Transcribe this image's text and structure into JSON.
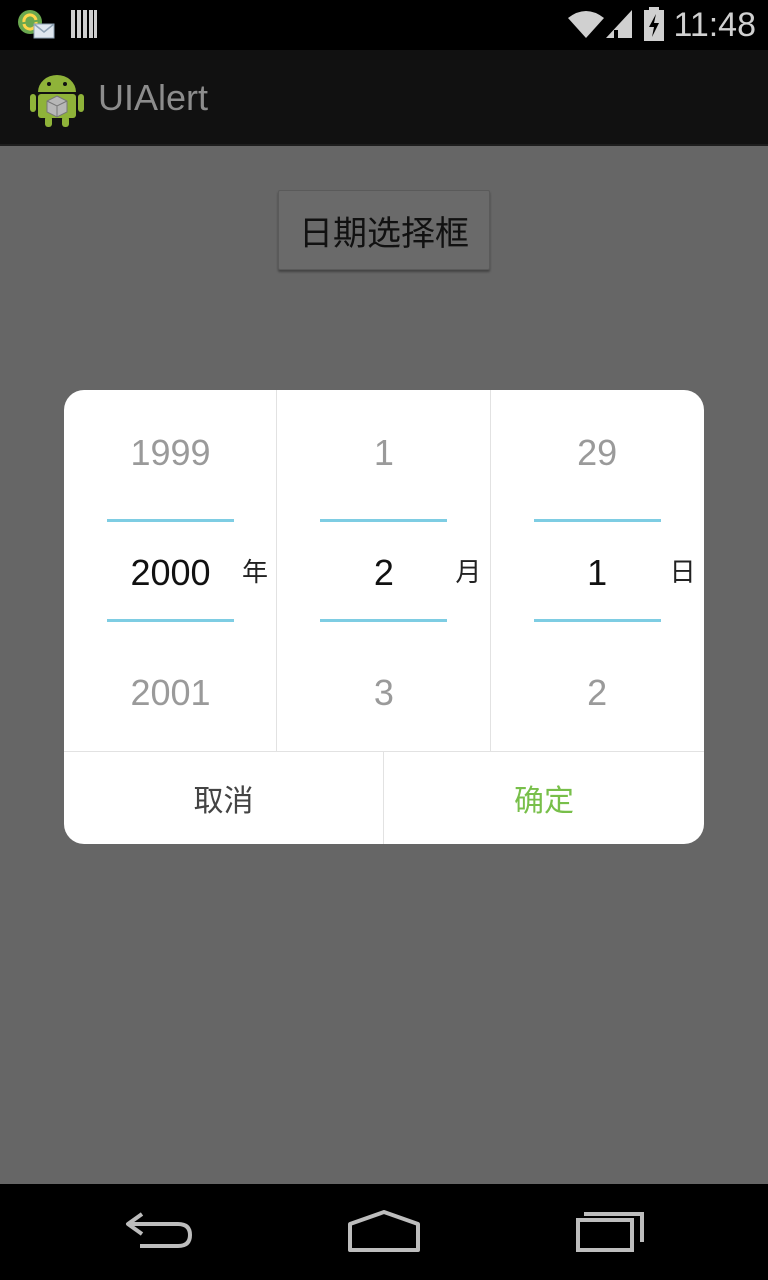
{
  "status_bar": {
    "time": "11:48",
    "icons": [
      "sync-mail-notification-icon",
      "barcode-notification-icon",
      "wifi-icon",
      "cell-signal-icon",
      "battery-charging-icon"
    ]
  },
  "action_bar": {
    "title": "UIAlert",
    "logo_icon": "android-robot-icon"
  },
  "main": {
    "date_button_label": "日期选择框"
  },
  "dialog": {
    "year": {
      "prev": "1999",
      "current": "2000",
      "next": "2001",
      "unit": "年"
    },
    "month": {
      "prev": "1",
      "current": "2",
      "next": "3",
      "unit": "月"
    },
    "day": {
      "prev": "29",
      "current": "1",
      "next": "2",
      "unit": "日"
    },
    "cancel_label": "取消",
    "ok_label": "确定"
  },
  "colors": {
    "accent_line": "#7ecde3",
    "ok_text": "#78bf4a",
    "scrim": "#666666"
  },
  "nav_bar": {
    "icons": [
      "back-icon",
      "home-icon",
      "recent-apps-icon"
    ]
  }
}
